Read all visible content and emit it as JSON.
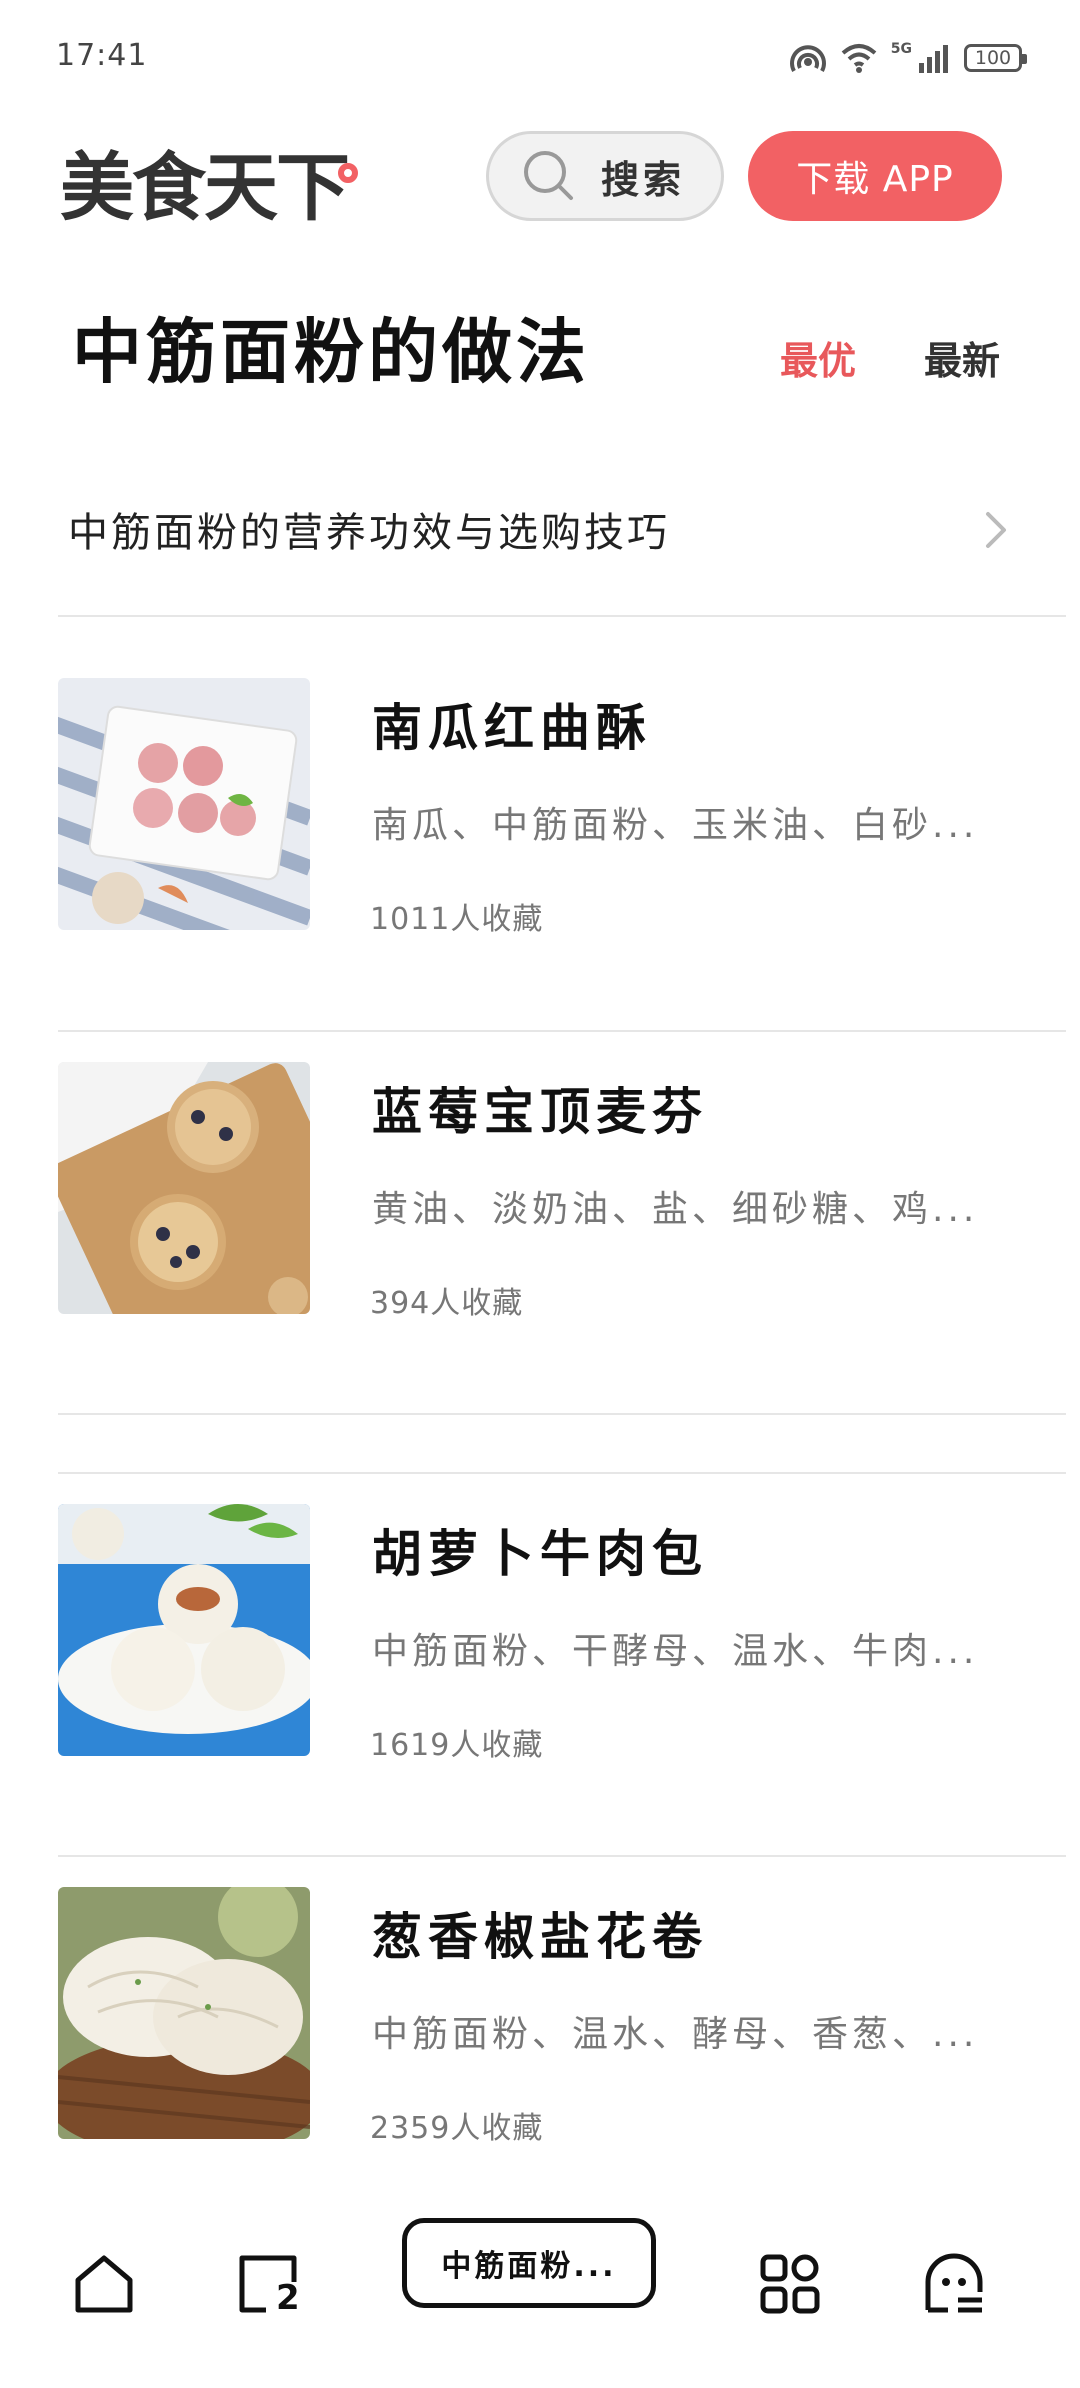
{
  "status_bar": {
    "time": "17:41",
    "network": "5G",
    "battery": "100"
  },
  "header": {
    "logo": "美食天下",
    "search_label": "搜索",
    "download_label": "下载 APP",
    "accent_color": "#f26164"
  },
  "page": {
    "title": "中筋面粉的做法",
    "tabs": [
      "最优",
      "最新"
    ],
    "active_tab": "最优",
    "tips_link": "中筋面粉的营养功效与选购技巧"
  },
  "recipes": [
    {
      "name": "南瓜红曲酥",
      "ingredients": "南瓜、中筋面粉、玉米油、白砂...",
      "favorites": "1011人收藏"
    },
    {
      "name": "蓝莓宝顶麦芬",
      "ingredients": "黄油、淡奶油、盐、细砂糖、鸡...",
      "favorites": "394人收藏"
    },
    {
      "name": "胡萝卜牛肉包",
      "ingredients": "中筋面粉、干酵母、温水、牛肉...",
      "favorites": "1619人收藏"
    },
    {
      "name": "葱香椒盐花卷",
      "ingredients": "中筋面粉、温水、酵母、香葱、...",
      "favorites": "2359人收藏"
    }
  ],
  "bottom_nav": {
    "items": [
      "home-icon",
      "tabs-icon",
      "current-tab",
      "apps-icon",
      "profile-icon"
    ],
    "tab_count": "2",
    "current_tab_label": "中筋面粉..."
  }
}
